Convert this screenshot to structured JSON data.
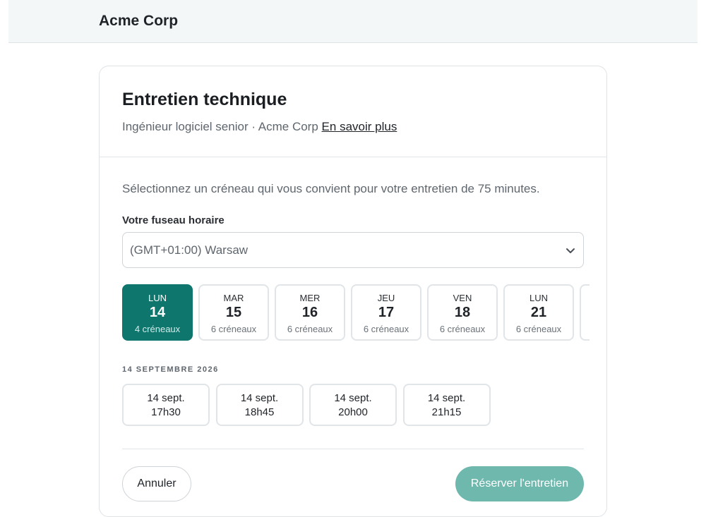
{
  "header": {
    "brand": "Acme Corp"
  },
  "card": {
    "title": "Entretien technique",
    "subtitle_prefix": "Ingénieur logiciel senior · Acme Corp",
    "learn_more": "En savoir plus",
    "intro": "Sélectionnez un créneau qui vous convient pour votre entretien de 75 minutes."
  },
  "timezone": {
    "label": "Votre fuseau horaire",
    "value": "(GMT+01:00) Warsaw",
    "icon": "chevron-down-icon"
  },
  "days": [
    {
      "dow": "LUN",
      "num": "14",
      "slots": "4 créneaux",
      "selected": true
    },
    {
      "dow": "MAR",
      "num": "15",
      "slots": "6 créneaux",
      "selected": false
    },
    {
      "dow": "MER",
      "num": "16",
      "slots": "6 créneaux",
      "selected": false
    },
    {
      "dow": "JEU",
      "num": "17",
      "slots": "6 créneaux",
      "selected": false
    },
    {
      "dow": "VEN",
      "num": "18",
      "slots": "6 créneaux",
      "selected": false
    },
    {
      "dow": "LUN",
      "num": "21",
      "slots": "6 créneaux",
      "selected": false
    }
  ],
  "selected_date_label": "14 SEPTEMBRE 2026",
  "times": [
    {
      "line1": "14 sept.",
      "line2": "17h30"
    },
    {
      "line1": "14 sept.",
      "line2": "18h45"
    },
    {
      "line1": "14 sept.",
      "line2": "20h00"
    },
    {
      "line1": "14 sept.",
      "line2": "21h15"
    }
  ],
  "actions": {
    "cancel": "Annuler",
    "book": "Réserver l'entretien"
  },
  "colors": {
    "accent": "#0f766e",
    "accent_disabled": "#6fb8ad",
    "topbar_bg": "#f4f7f8"
  }
}
